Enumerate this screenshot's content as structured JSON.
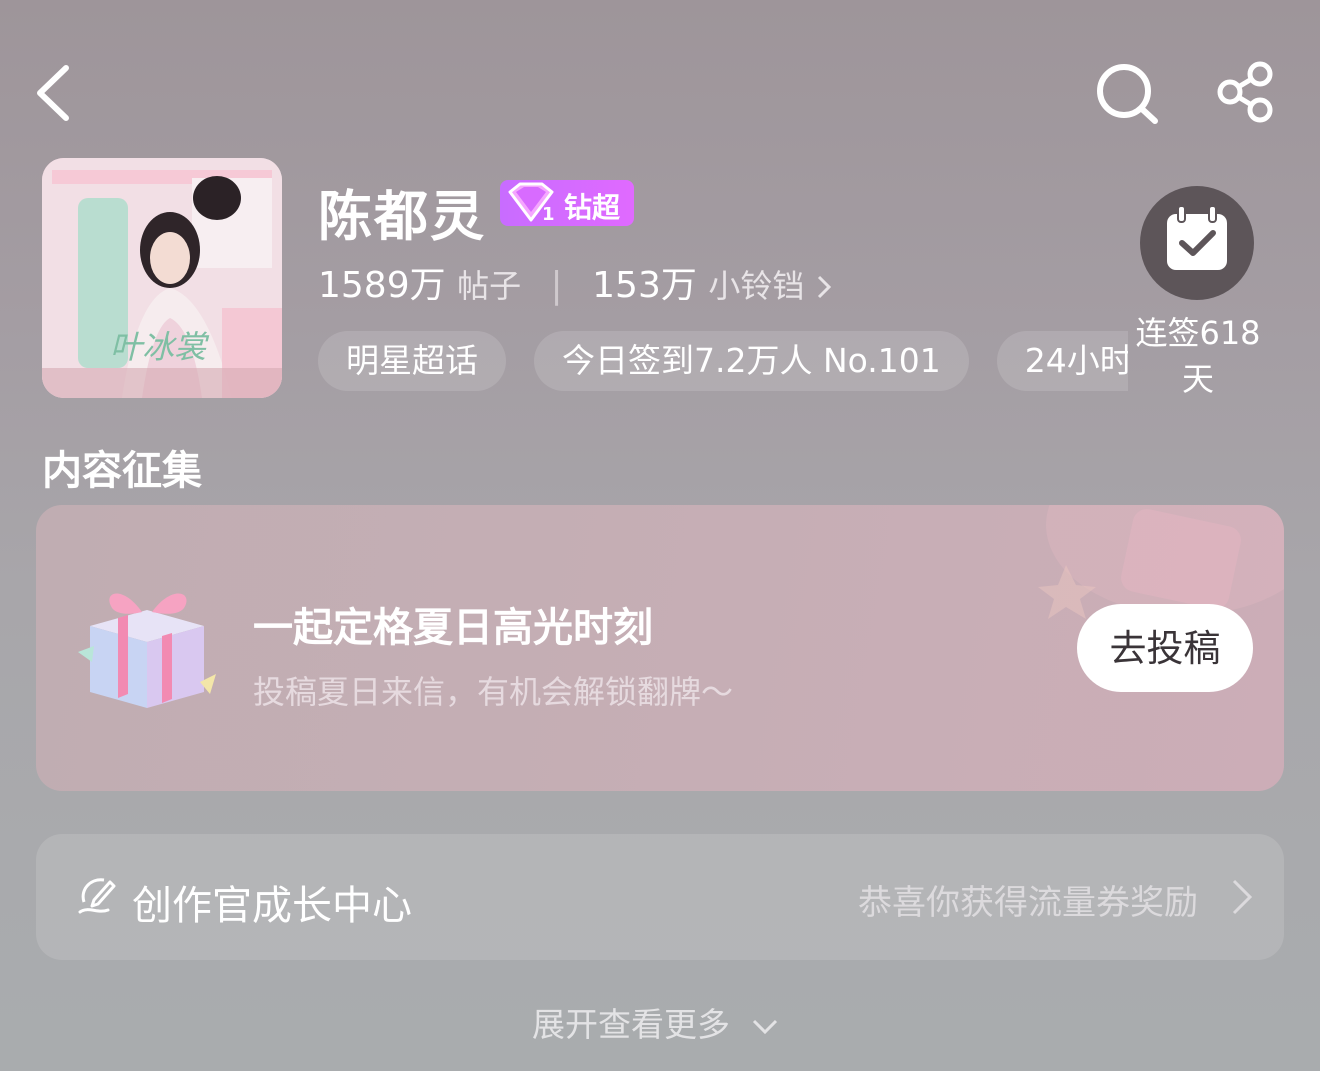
{
  "header": {
    "back_icon": "back-arrow-icon",
    "search_icon": "search-icon",
    "share_icon": "share-icon"
  },
  "profile": {
    "name": "陈都灵",
    "badge_level": "1",
    "badge_label": "钻超",
    "posts_count": "1589万",
    "posts_label": "帖子",
    "bells_count": "153万",
    "bells_label": "小铃铛",
    "cover_caption": "叶冰裳",
    "tags": [
      "明星超话",
      "今日签到7.2万人 No.101",
      "24小时"
    ]
  },
  "checkin": {
    "icon": "calendar-check-icon",
    "label": "连签618天"
  },
  "section": {
    "title": "内容征集"
  },
  "campaign": {
    "title": "一起定格夏日高光时刻",
    "subtitle": "投稿夏日来信，有机会解锁翻牌～",
    "button": "去投稿",
    "icon": "gift-box-icon"
  },
  "creator_center": {
    "icon": "creator-pen-icon",
    "label": "创作官成长中心",
    "reward_text": "恭喜你获得流量券奖励"
  },
  "expand": {
    "label": "展开查看更多"
  },
  "colors": {
    "badge_gradient_start": "#c86cff",
    "badge_gradient_end": "#e06aff",
    "checkin_bg": "#5d5559"
  }
}
